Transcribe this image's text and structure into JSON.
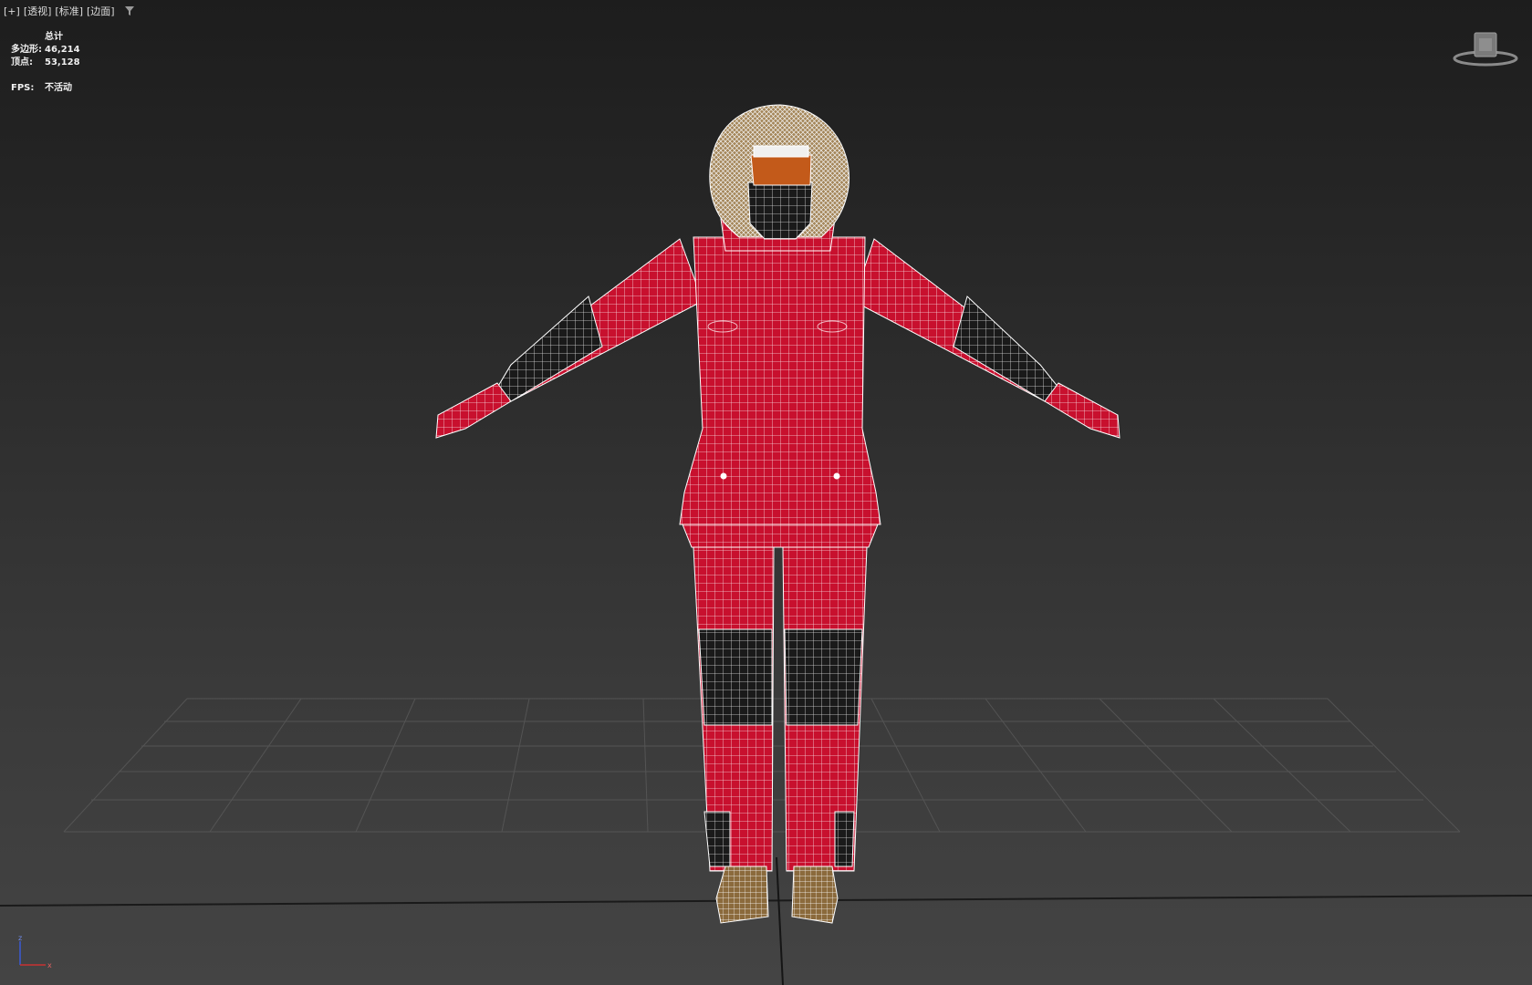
{
  "viewport": {
    "labels": [
      "[+]",
      "[透视]",
      "[标准]",
      "[边面]"
    ],
    "stats": {
      "title": "总计",
      "polygons_label": "多边形:",
      "polygons_value": "46,214",
      "vertices_label": "顶点:",
      "vertices_value": "53,128",
      "fps_label": "FPS:",
      "fps_value": "不活动"
    },
    "viewcube_icon": "viewcube-icon",
    "filter_icon": "filter-icon",
    "axis": {
      "z": "z",
      "x": "x"
    },
    "colors": {
      "mesh_red": "#c8102e",
      "mesh_dark": "#1a1a1a",
      "wire": "#ffffff",
      "boots": "#8b6a3c"
    }
  }
}
